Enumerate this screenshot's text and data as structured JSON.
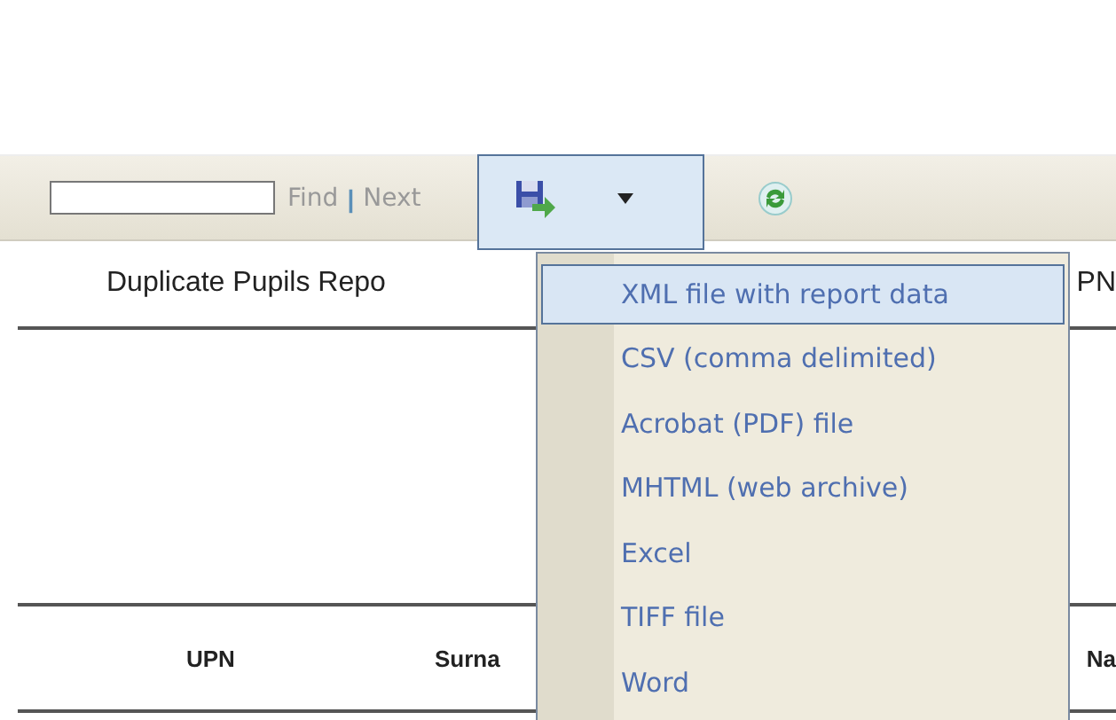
{
  "toolbar": {
    "find_label": "Find",
    "separator": "|",
    "next_label": "Next"
  },
  "report": {
    "title": "Duplicate Pupils Repo",
    "title_right": "PN"
  },
  "table": {
    "columns": [
      "UPN",
      "Surna",
      "Na"
    ]
  },
  "export_menu": {
    "items": [
      {
        "label": "XML file with report data",
        "selected": true
      },
      {
        "label": "CSV (comma delimited)",
        "selected": false
      },
      {
        "label": "Acrobat (PDF) file",
        "selected": false
      },
      {
        "label": "MHTML (web archive)",
        "selected": false
      },
      {
        "label": "Excel",
        "selected": false
      },
      {
        "label": "TIFF file",
        "selected": false
      },
      {
        "label": "Word",
        "selected": false
      }
    ]
  }
}
